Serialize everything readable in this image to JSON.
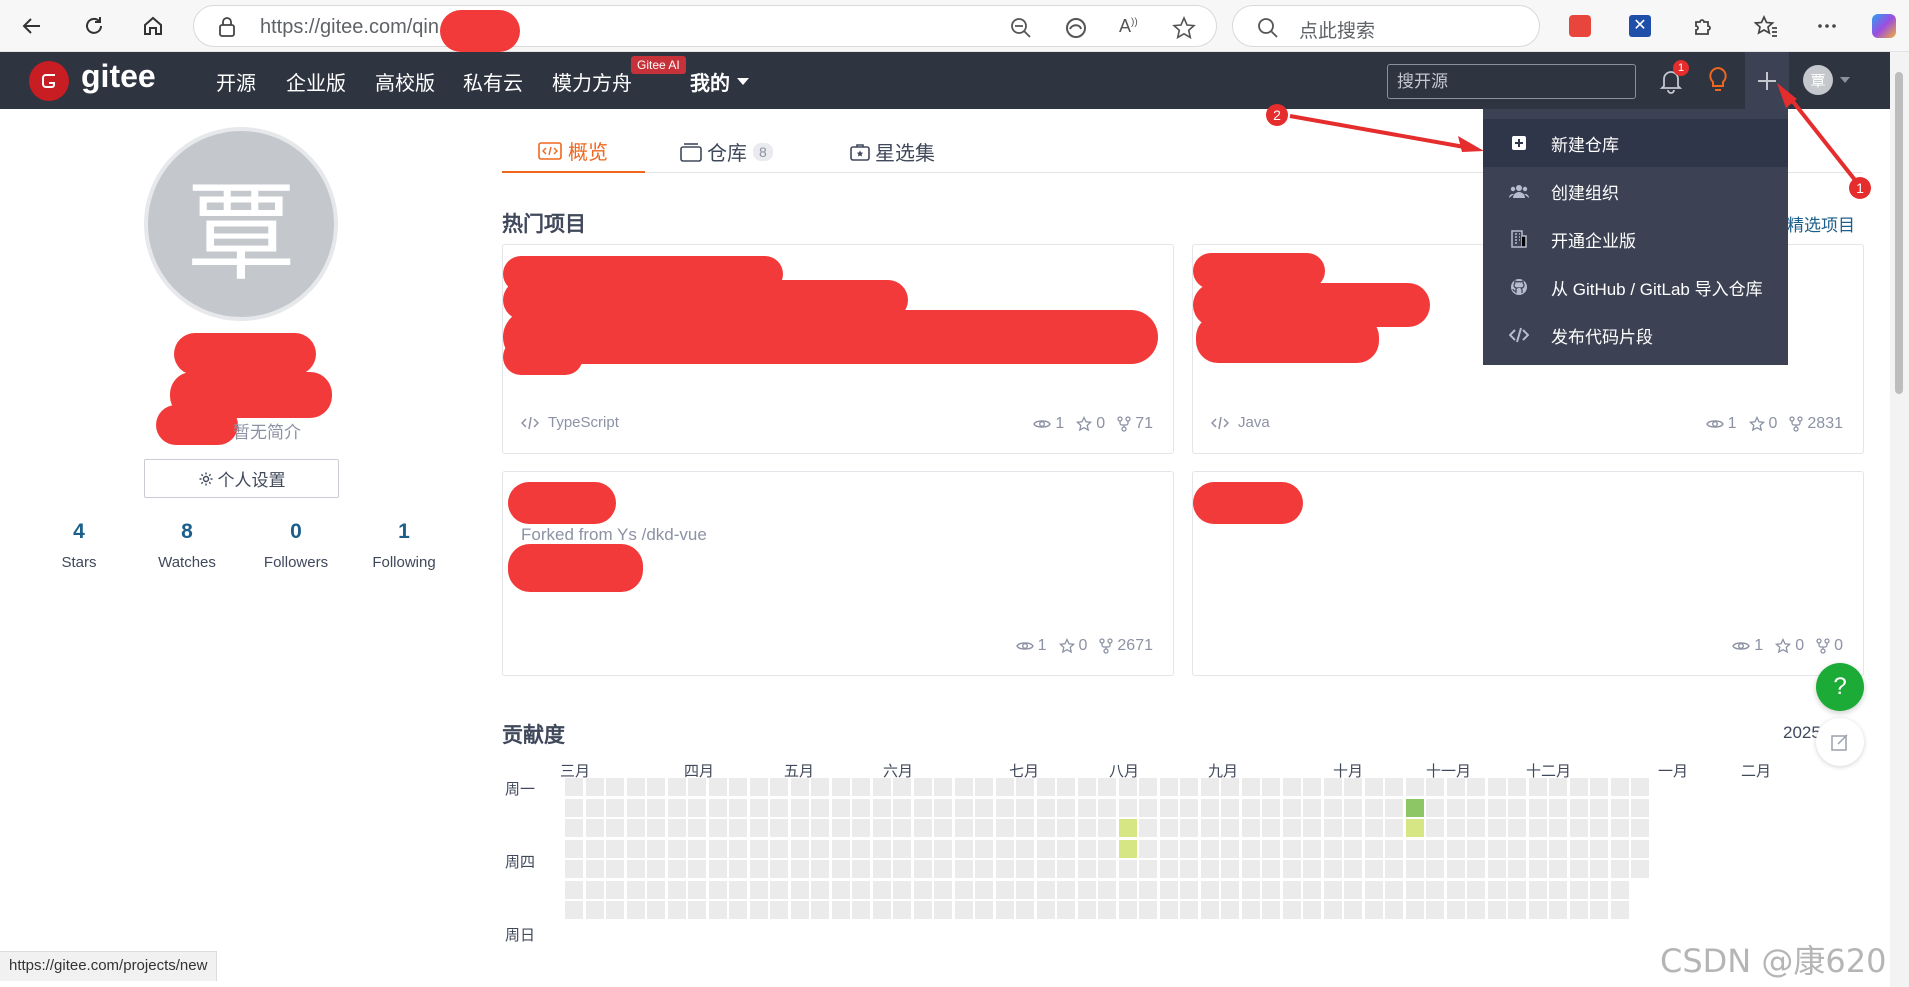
{
  "browser": {
    "url": "https://gitee.com/qin",
    "search_placeholder": "点此搜索"
  },
  "nav": {
    "logo_text": "gitee",
    "links": [
      "开源",
      "企业版",
      "高校版",
      "私有云",
      "模力方舟",
      "我的"
    ],
    "ai_badge": "Gitee AI",
    "search_placeholder": "搜开源",
    "notification_count": "1",
    "avatar_char": "覃"
  },
  "dropdown": {
    "items": [
      "新建仓库",
      "创建组织",
      "开通企业版",
      "从 GitHub / GitLab 导入仓库",
      "发布代码片段"
    ]
  },
  "profile": {
    "avatar_char": "覃",
    "intro": "暂无简介",
    "settings_label": "个人设置",
    "stats": [
      {
        "num": "4",
        "label": "Stars"
      },
      {
        "num": "8",
        "label": "Watches"
      },
      {
        "num": "0",
        "label": "Followers"
      },
      {
        "num": "1",
        "label": "Following"
      }
    ]
  },
  "tabs": [
    {
      "label": "概览"
    },
    {
      "label": "仓库",
      "count": "8"
    },
    {
      "label": "星选集"
    }
  ],
  "hot": {
    "title": "热门项目",
    "more": "精选项目"
  },
  "cards": [
    {
      "lang": "TypeScript",
      "watch": "1",
      "star": "0",
      "fork": "71"
    },
    {
      "lang": "Java",
      "watch": "1",
      "star": "0",
      "fork": "2831"
    },
    {
      "forked": "Forked from Ys /dkd-vue",
      "watch": "1",
      "star": "0",
      "fork": "2671"
    },
    {
      "watch": "1",
      "star": "0",
      "fork": "0"
    }
  ],
  "contrib": {
    "title": "贡献度",
    "year": "2025",
    "months": [
      "三月",
      "四月",
      "五月",
      "六月",
      "七月",
      "八月",
      "九月",
      "十月",
      "十一月",
      "十二月",
      "一月",
      "二月"
    ],
    "weekdays": [
      "周一",
      "周四",
      "周日"
    ]
  },
  "float": {
    "help": "?"
  },
  "status_url": "https://gitee.com/projects/new",
  "annotations": {
    "marker1": "1",
    "marker2": "2"
  },
  "watermark": "CSDN @康620",
  "colors": {
    "nav_bg": "#2e3440",
    "accent_orange": "#f0661e",
    "link_blue": "#1c5f8a",
    "help_green": "#1bab36",
    "redaction": "#f23a3a"
  }
}
